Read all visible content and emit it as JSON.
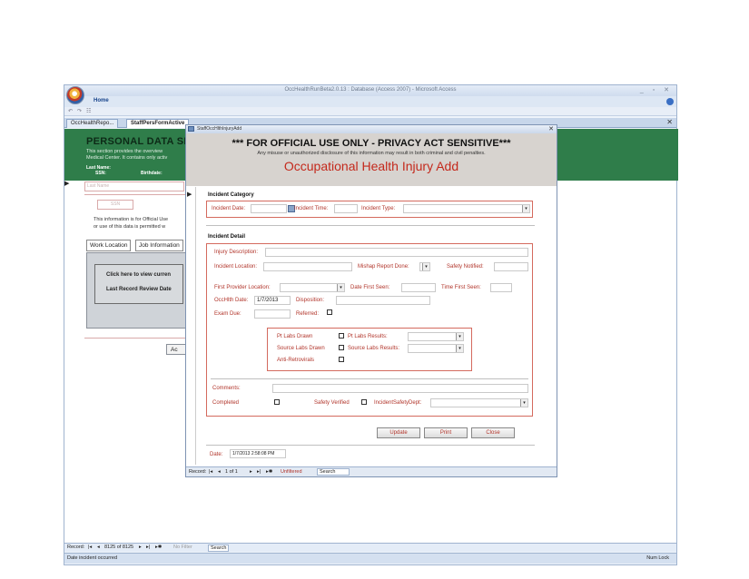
{
  "app": {
    "title": "OccHealthRunBeta2.0.13 : Database (Access 2007) - Microsoft Access",
    "ribbon_tab": "Home",
    "window_controls": "_ ▫ ✕",
    "doc_tabs": [
      "OccHealthRepo...",
      "StaffPersFormActive"
    ],
    "doc_close": "✕"
  },
  "background_form": {
    "header_title": "PERSONAL DATA SH",
    "subtitle1": "This section provides the overview",
    "subtitle2": "Medical Center. It contains only activ",
    "label_last_name": "Last Name:",
    "label_ssn": "SSN:",
    "label_birthdate": "Birthdate:",
    "last_name_placeholder": "Last Name",
    "ssn_placeholder": "SSN",
    "note1": "This information is for Official Use",
    "note2": "or use of this data is permitted w",
    "tab_work_location": "Work Location",
    "tab_job_information": "Job Information",
    "panel_line1": "Click here to view curren",
    "panel_line2": "Last Record Review Date",
    "ac_button": "Ac",
    "record_nav": {
      "label": "Record:",
      "first": "|◂",
      "prev": "◂",
      "position": "8125 of 8125",
      "next": "▸",
      "last": "▸|",
      "new": "▸✱",
      "filter": "No Filter",
      "search": "Search"
    },
    "status_left": "Date incident occurred",
    "status_right": "Num Lock"
  },
  "dialog": {
    "title": "StaffOccHlthInjuryAdd",
    "close": "✕",
    "header_line1": "*** FOR OFFICIAL USE ONLY - PRIVACY ACT SENSITIVE***",
    "header_line2": "Any misuse or unauthorized disclosure of this information may result in both criminal and civil penalties.",
    "header_title": "Occupational Health Injury Add",
    "incident_category": {
      "section_title": "Incident Category",
      "incident_date_label": "Incident Date:",
      "incident_time_label": "Incident Time:",
      "incident_type_label": "Incident Type:"
    },
    "incident_detail": {
      "section_title": "Incident Detail",
      "injury_description_label": "Injury Description:",
      "incident_location_label": "Incident Location:",
      "mishap_report_label": "Mishap Report Done:",
      "safety_notified_label": "Safety Notified:",
      "first_provider_label": "First Provider Location:",
      "date_first_seen_label": "Date First Seen:",
      "time_first_seen_label": "Time First Seen:",
      "occhlth_date_label": "OccHlth Date:",
      "occhlth_date_value": "1/7/2013",
      "disposition_label": "Disposition:",
      "exam_due_label": "Exam Due:",
      "referred_label": "Referred:",
      "pt_labs_drawn_label": "Pt Labs Drawn",
      "pt_labs_results_label": "Pt Labs Results:",
      "source_labs_drawn_label": "Source Labs Drawn",
      "source_labs_results_label": "Source Labs Results:",
      "anti_retrovirals_label": "Anti-Retrovirals",
      "comments_label": "Comments:",
      "completed_label": "Completed",
      "safety_verified_label": "Safety Verified",
      "incident_safety_dept_label": "IncidentSafetyDept:"
    },
    "buttons": {
      "update": "Update",
      "print": "Print",
      "close": "Close"
    },
    "date_label": "Date:",
    "date_value": "1/7/2013 2:58:08 PM",
    "record_nav": {
      "label": "Record:",
      "first": "|◂",
      "prev": "◂",
      "position": "1 of 1",
      "next": "▸",
      "last": "▸|",
      "new": "▸✱",
      "filter": "Unfiltered",
      "search": "Search"
    }
  }
}
